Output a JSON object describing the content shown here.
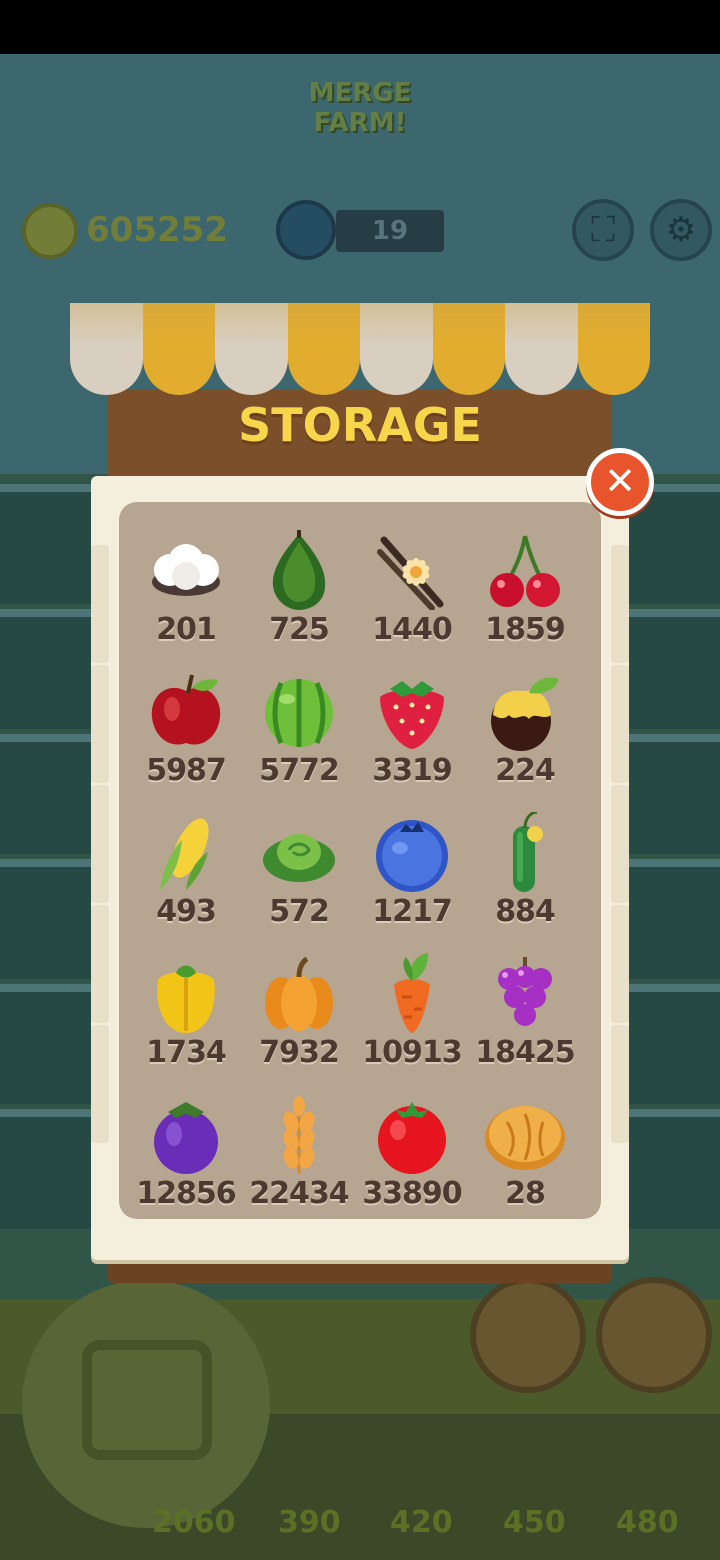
{
  "header": {
    "logo_line1": "MERGE",
    "logo_line2": "FARM!",
    "coins": "605252",
    "level": "19",
    "fullscreen_icon": "expand-icon",
    "settings_icon": "gear-icon"
  },
  "modal": {
    "title": "STORAGE",
    "close_icon": "close-icon",
    "colors": {
      "awning_yellow": "#e2ad2e",
      "awning_white": "#d9cfc0",
      "board": "#7b4f2a",
      "paper": "#f4eedc",
      "panel": "#b5a591",
      "close": "#e8552d",
      "title": "#f7d64b"
    },
    "items": [
      {
        "name": "cotton",
        "count": "201"
      },
      {
        "name": "avocado",
        "count": "725"
      },
      {
        "name": "vanilla",
        "count": "1440"
      },
      {
        "name": "cherry",
        "count": "1859"
      },
      {
        "name": "apple",
        "count": "5987"
      },
      {
        "name": "watermelon",
        "count": "5772"
      },
      {
        "name": "strawberry",
        "count": "3319"
      },
      {
        "name": "caramel-apple",
        "count": "224"
      },
      {
        "name": "corn",
        "count": "493"
      },
      {
        "name": "cabbage",
        "count": "572"
      },
      {
        "name": "blueberry",
        "count": "1217"
      },
      {
        "name": "cucumber",
        "count": "884"
      },
      {
        "name": "yellow-pepper",
        "count": "1734"
      },
      {
        "name": "pumpkin",
        "count": "7932"
      },
      {
        "name": "carrot",
        "count": "10913"
      },
      {
        "name": "grapes",
        "count": "18425"
      },
      {
        "name": "eggplant",
        "count": "12856"
      },
      {
        "name": "wheat",
        "count": "22434"
      },
      {
        "name": "tomato",
        "count": "33890"
      },
      {
        "name": "bread",
        "count": "28"
      }
    ]
  },
  "bottom_bar": {
    "prices": [
      "2060",
      "390",
      "420",
      "450",
      "480"
    ]
  }
}
